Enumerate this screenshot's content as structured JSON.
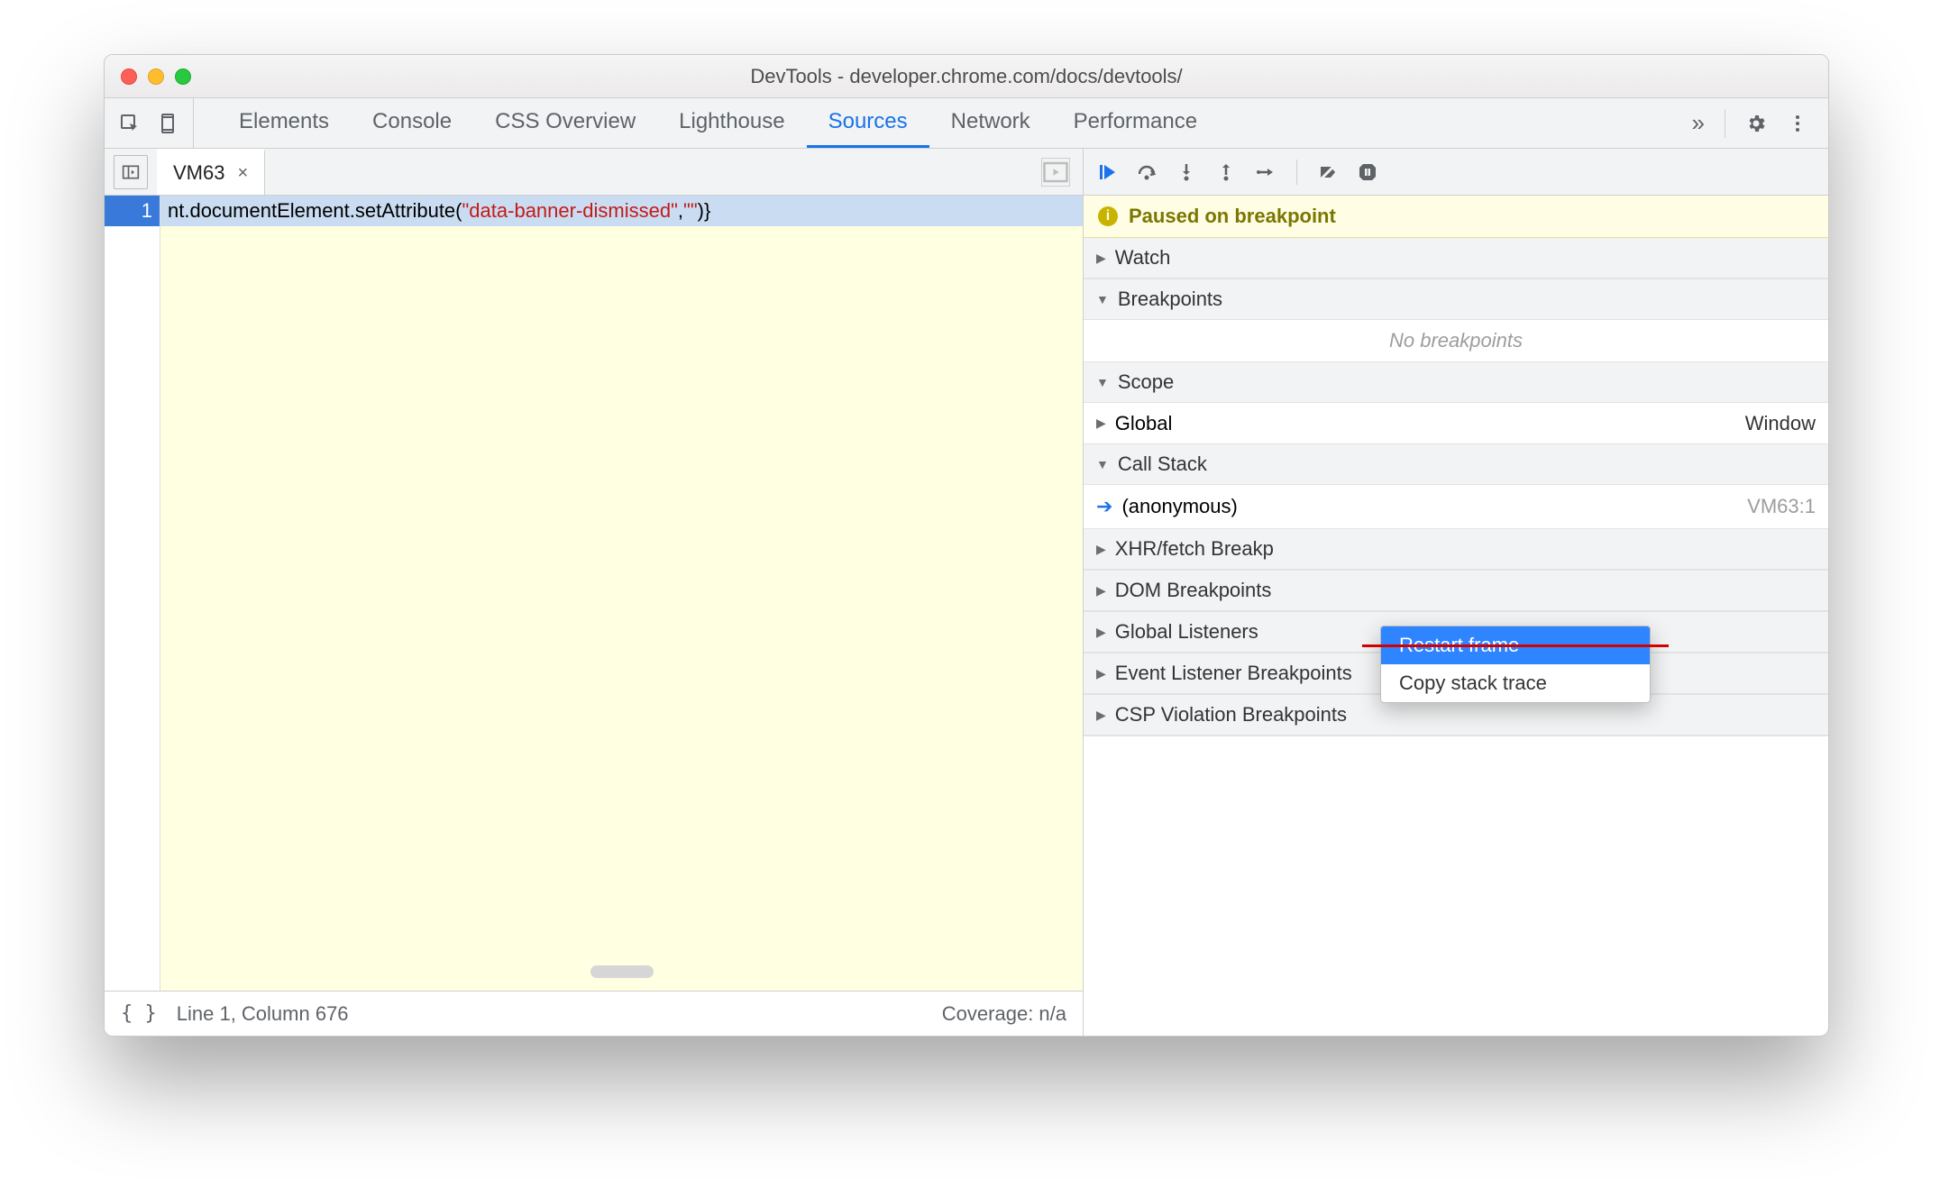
{
  "window": {
    "title": "DevTools - developer.chrome.com/docs/devtools/"
  },
  "tabs": {
    "items": [
      "Elements",
      "Console",
      "CSS Overview",
      "Lighthouse",
      "Sources",
      "Network",
      "Performance"
    ],
    "active": "Sources",
    "overflow_glyph": "»"
  },
  "file": {
    "name": "VM63",
    "close_glyph": "×"
  },
  "code": {
    "line_number": "1",
    "prefix": "nt.documentElement.setAttribute(",
    "arg1": "\"data-banner-dismissed\"",
    "comma": ",",
    "arg2": "\"\"",
    "suffix": ")}"
  },
  "statusbar": {
    "braces": "{ }",
    "position": "Line 1, Column 676",
    "coverage": "Coverage: n/a"
  },
  "paused": {
    "text": "Paused on breakpoint"
  },
  "sidebar": {
    "watch": "Watch",
    "breakpoints": {
      "title": "Breakpoints",
      "empty": "No breakpoints"
    },
    "scope": {
      "title": "Scope",
      "global": "Global",
      "global_value": "Window"
    },
    "callstack": {
      "title": "Call Stack",
      "frame": "(anonymous)",
      "location": "VM63:1"
    },
    "xhr": "XHR/fetch Breakp",
    "dom": "DOM Breakpoints",
    "global_listeners": "Global Listeners",
    "event_listener_bp": "Event Listener Breakpoints",
    "csp": "CSP Violation Breakpoints"
  },
  "context_menu": {
    "restart_frame": "Restart frame",
    "copy_stack": "Copy stack trace"
  }
}
